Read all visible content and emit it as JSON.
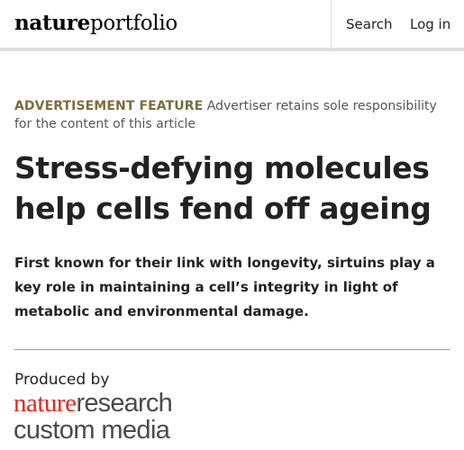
{
  "header": {
    "logo_bold": "nature",
    "logo_light": "portfolio",
    "nav": {
      "search_label": "Search",
      "login_label": "Log in"
    }
  },
  "article": {
    "advert_label": "ADVERTISEMENT FEATURE",
    "advert_disclaimer": "Advertiser retains sole responsibility for the content of this article",
    "title": "Stress-defying molecules help cells fend off ageing",
    "standfirst": "First known for their link with longevity, sirtuins play a key role in maintaining a cell’s integrity in light of metabolic and environmental damage."
  },
  "producer": {
    "produced_by": "Produced by",
    "logo_nature": "nature",
    "logo_research": "research",
    "logo_custom_media": "custom media"
  },
  "colors": {
    "advert_label": "#7a6c3d",
    "logo_nature_red": "#e8251f",
    "logo_grey": "#4a4a4a",
    "header_border": "#dedede"
  }
}
